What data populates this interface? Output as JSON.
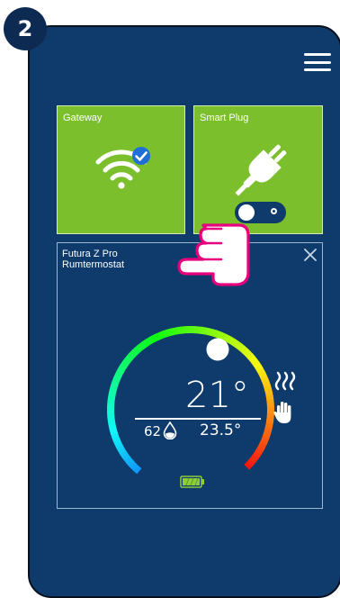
{
  "step": {
    "number": "2"
  },
  "devices": {
    "gateway": {
      "label": "Gateway",
      "status": "connected",
      "icon": "wifi-icon"
    },
    "smart_plug": {
      "label": "Smart Plug",
      "state": "off",
      "icon": "plug-icon"
    }
  },
  "thermostat": {
    "name": "Futura Z Pro",
    "type": "Rumtermostat",
    "current_temp": "21°",
    "humidity": "62",
    "set_temp": "23.5°",
    "mode_icons": [
      "heat-waves-icon",
      "hand-manual-icon"
    ],
    "battery_icon": "battery-icon"
  },
  "colors": {
    "background": "#0e3b6c",
    "tile": "#7bbf2c",
    "pointer": "#e6007e"
  }
}
